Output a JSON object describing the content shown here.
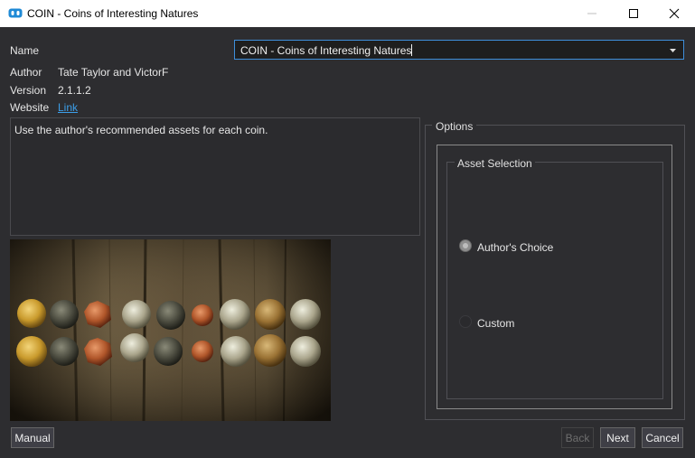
{
  "window": {
    "title": "COIN - Coins of Interesting Natures",
    "controls": [
      "minimize",
      "maximize",
      "close"
    ]
  },
  "fields": {
    "name_label": "Name",
    "name_value": "COIN - Coins of Interesting Natures",
    "author_label": "Author",
    "author_value": "Tate Taylor and VictorF",
    "version_label": "Version",
    "version_value": "2.1.1.2",
    "website_label": "Website",
    "website_link": "Link"
  },
  "description": "Use the author's recommended assets for each coin.",
  "options": {
    "group_label": "Options",
    "asset_selection": {
      "label": "Asset Selection",
      "choices": [
        {
          "label": "Author's Choice",
          "selected": true
        },
        {
          "label": "Custom",
          "selected": false
        }
      ]
    }
  },
  "buttons": {
    "manual": "Manual",
    "back": "Back",
    "next": "Next",
    "cancel": "Cancel"
  },
  "colors": {
    "background": "#2d2d30",
    "accent": "#3e8ed9",
    "link": "#3c9ee8"
  }
}
